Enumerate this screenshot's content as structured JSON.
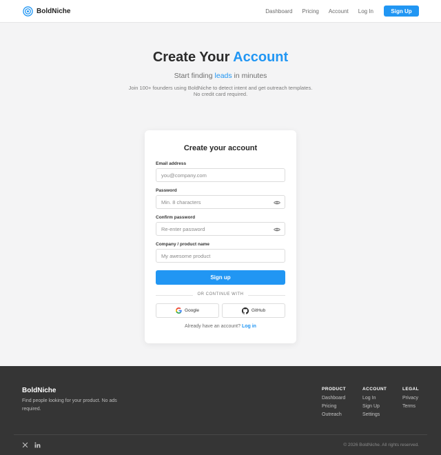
{
  "header": {
    "brand": "BoldNiche",
    "nav": [
      "Dashboard",
      "Pricing",
      "Account",
      "Log In"
    ],
    "cta": "Sign Up"
  },
  "hero": {
    "title_prefix": "Create Your ",
    "title_accent": "Account",
    "subtitle_prefix": "Start finding ",
    "subtitle_accent": "leads",
    "subtitle_suffix": " in minutes",
    "description_line1": "Join 100+ founders using BoldNiche to detect intent and get outreach templates.",
    "description_line2": "No credit card required."
  },
  "form": {
    "title": "Create your account",
    "email_label": "Email address",
    "email_placeholder": "you@company.com",
    "password_label": "Password",
    "password_placeholder": "Min. 8 characters",
    "confirm_label": "Confirm password",
    "confirm_placeholder": "Re-enter password",
    "company_label": "Company / product name",
    "company_placeholder": "My awesome product",
    "submit": "Sign up",
    "divider": "OR CONTINUE WITH",
    "google": "Google",
    "github": "GitHub",
    "signin_prompt": "Already have an account?",
    "signin_link": "Log in"
  },
  "footer": {
    "brand": "BoldNiche",
    "description": "Find people looking for your product. No ads required.",
    "columns": [
      {
        "title": "PRODUCT",
        "items": [
          "Dashboard",
          "Pricing",
          "Outreach"
        ]
      },
      {
        "title": "ACCOUNT",
        "items": [
          "Log In",
          "Sign Up",
          "Settings"
        ]
      },
      {
        "title": "LEGAL",
        "items": [
          "Privacy",
          "Terms"
        ]
      }
    ],
    "copyright": "© 2026 BoldNiche. All rights reserved.",
    "social_icons": [
      "x-icon",
      "linkedin-icon"
    ]
  },
  "colors": {
    "accent": "#2196f3",
    "footer_bg": "#353535",
    "page_bg": "#f4f4f5"
  }
}
